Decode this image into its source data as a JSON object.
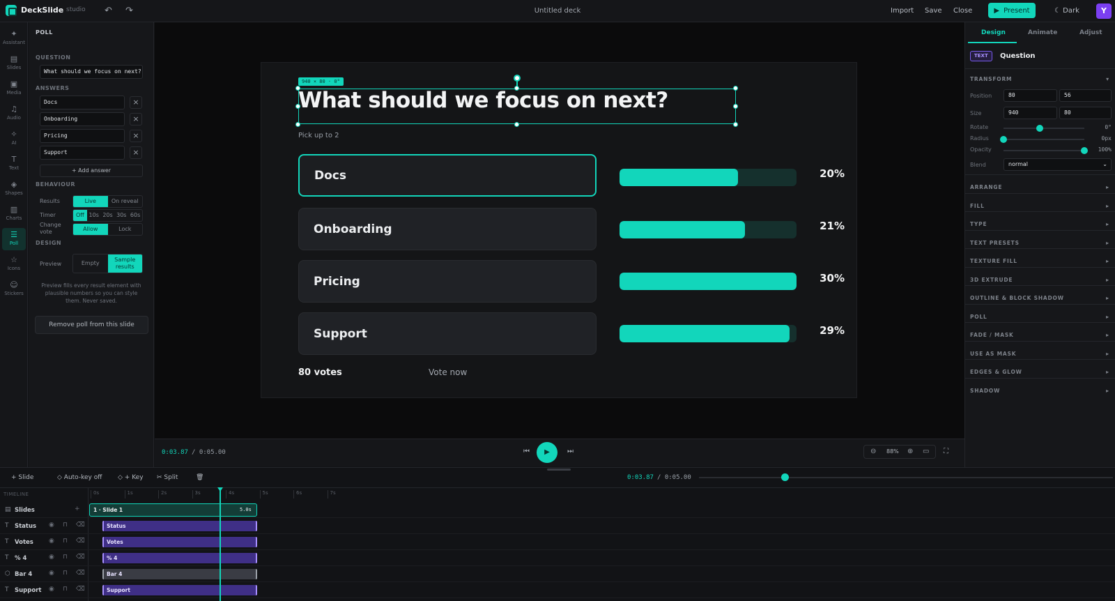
{
  "app": {
    "brand": "DeckSlide",
    "brand_sub": "studio",
    "deck_title": "Untitled deck",
    "user_initial": "Y"
  },
  "topnav": {
    "import": "Import",
    "save": "Save",
    "close": "Close",
    "present": "Present",
    "theme": "Dark"
  },
  "rail": [
    {
      "label": "Assistant",
      "icon": "sparkle-icon"
    },
    {
      "label": "Slides",
      "icon": "slides-icon"
    },
    {
      "label": "Media",
      "icon": "image-icon"
    },
    {
      "label": "Audio",
      "icon": "music-icon"
    },
    {
      "label": "AI",
      "icon": "ai-icon"
    },
    {
      "label": "Text",
      "icon": "text-icon"
    },
    {
      "label": "Shapes",
      "icon": "shapes-icon"
    },
    {
      "label": "Charts",
      "icon": "chart-icon"
    },
    {
      "label": "Poll",
      "icon": "poll-icon",
      "active": true
    },
    {
      "label": "Icons",
      "icon": "star-icon"
    },
    {
      "label": "Stickers",
      "icon": "sticker-icon"
    }
  ],
  "poll_panel": {
    "title": "POLL",
    "question_label": "QUESTION",
    "question_value": "What should we focus on next?",
    "answers_label": "ANSWERS",
    "answers": [
      "Docs",
      "Onboarding",
      "Pricing",
      "Support"
    ],
    "add_answer": "+ Add answer",
    "behaviour_label": "BEHAVIOUR",
    "results_label": "Results",
    "results_options": [
      "Live",
      "On reveal"
    ],
    "timer_label": "Timer",
    "timer_options": [
      "Off",
      "10s",
      "20s",
      "30s",
      "60s"
    ],
    "change_vote_label": "Change vote",
    "change_vote_options": [
      "Allow",
      "Lock"
    ],
    "design_label": "DESIGN",
    "preview_label": "Preview",
    "preview_options": [
      "Empty",
      "Sample results"
    ],
    "note": "Preview fills every result element with plausible numbers so you can style them. Never saved.",
    "remove": "Remove poll from this slide"
  },
  "slide": {
    "title": "What should we focus on next?",
    "subtitle": "Pick up to 2",
    "dim_tag": "940 × 80 · 0°",
    "options": [
      {
        "label": "Docs",
        "percent": "20%",
        "fill": 0.67,
        "selected": true
      },
      {
        "label": "Onboarding",
        "percent": "21%",
        "fill": 0.71
      },
      {
        "label": "Pricing",
        "percent": "30%",
        "fill": 1.0
      },
      {
        "label": "Support",
        "percent": "29%",
        "fill": 0.96
      }
    ],
    "votes": "80 votes",
    "vote_now": "Vote now"
  },
  "playback": {
    "current": "0:03.87",
    "total": "/ 0:05.00",
    "zoom": "88%"
  },
  "right_panel": {
    "tabs": [
      "Design",
      "Animate",
      "Adjust"
    ],
    "badge": "TEXT",
    "selection": "Question",
    "transform_label": "TRANSFORM",
    "position_label": "Position",
    "pos_x": "80",
    "pos_y": "56",
    "size_label": "Size",
    "size_w": "940",
    "size_h": "80",
    "rotate_label": "Rotate",
    "rotate_val": "0°",
    "rotate_level": 0.45,
    "radius_label": "Radius",
    "radius_val": "0px",
    "radius_level": 0.0,
    "opacity_label": "Opacity",
    "opacity_val": "100%",
    "opacity_level": 1.0,
    "blend_label": "Blend",
    "blend_val": "normal",
    "sections": [
      "ARRANGE",
      "FILL",
      "TYPE",
      "TEXT PRESETS",
      "TEXTURE FILL",
      "3D EXTRUDE",
      "OUTLINE & BLOCK SHADOW",
      "POLL",
      "FADE / MASK",
      "USE AS MASK",
      "EDGES & GLOW",
      "SHADOW"
    ]
  },
  "timeline": {
    "toolbar": {
      "slide": "+ Slide",
      "autokey": "Auto-key off",
      "key": "+ Key",
      "split": "Split"
    },
    "current": "0:03.87",
    "total": "/ 0:05.00",
    "ruler_label": "TIMELINE",
    "ticks": [
      "0s",
      "1s",
      "2s",
      "3s",
      "4s",
      "5s",
      "6s",
      "7s"
    ],
    "slides_track": "Slides",
    "slide_clip": "1 · Slide 1",
    "slide_clip_dur": "5.0s",
    "tracks": [
      {
        "name": "Status",
        "clip": "Status",
        "icon": "T"
      },
      {
        "name": "Votes",
        "clip": "Votes",
        "icon": "T"
      },
      {
        "name": "% 4",
        "clip": "% 4",
        "icon": "T"
      },
      {
        "name": "Bar 4",
        "clip": "Bar 4",
        "icon": "shape"
      },
      {
        "name": "Support",
        "clip": "Support",
        "icon": "T"
      }
    ]
  },
  "colors": {
    "accent": "#12d6bb",
    "bg": "#121316",
    "slide_bg": "#141517",
    "clip_purple": "#3f2f86"
  }
}
